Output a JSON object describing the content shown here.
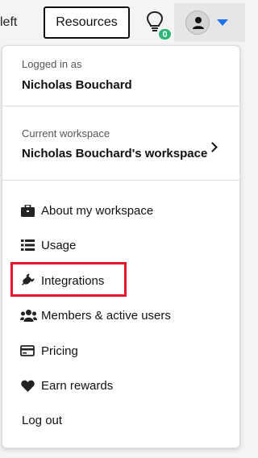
{
  "topbar": {
    "left_text": "left",
    "resources_label": "Resources",
    "notification_count": "0"
  },
  "menu": {
    "logged_in_caption": "Logged in as",
    "user_name": "Nicholas Bouchard",
    "workspace_caption": "Current workspace",
    "workspace_name": "Nicholas Bouchard's workspace",
    "items": [
      {
        "label": "About my workspace",
        "icon": "briefcase-icon"
      },
      {
        "label": "Usage",
        "icon": "list-icon"
      },
      {
        "label": "Integrations",
        "icon": "plug-icon"
      },
      {
        "label": "Members & active users",
        "icon": "users-icon"
      },
      {
        "label": "Pricing",
        "icon": "credit-card-icon"
      },
      {
        "label": "Earn rewards",
        "icon": "heart-icon"
      }
    ],
    "logout_label": "Log out"
  },
  "colors": {
    "accent": "#1a73e8",
    "badge": "#2bb673",
    "highlight": "#e3182a"
  }
}
